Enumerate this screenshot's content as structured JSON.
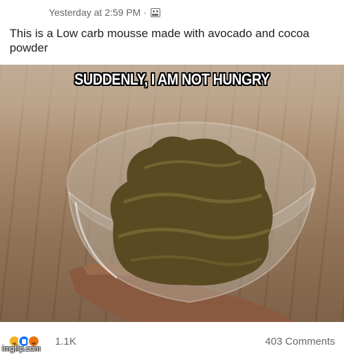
{
  "post": {
    "timestamp": "Yesterday at 2:59 PM",
    "separator": "·",
    "audience_icon": "friends-icon",
    "caption": "This is a Low carb mousse made with avocado and cocoa powder"
  },
  "meme": {
    "overlay_text": "SUDDENLY, I AM NOT HUNGRY"
  },
  "footer": {
    "reactions": [
      "haha-icon",
      "like-icon",
      "angry-icon"
    ],
    "reaction_count": "1.1K",
    "comments": "403 Comments",
    "watermark": "imgflip.com"
  },
  "colors": {
    "meta_text": "#65676b",
    "caption_text": "#1c1e21",
    "like": "#1877f2",
    "haha": "#f7b125",
    "angry": "#e9710f"
  }
}
